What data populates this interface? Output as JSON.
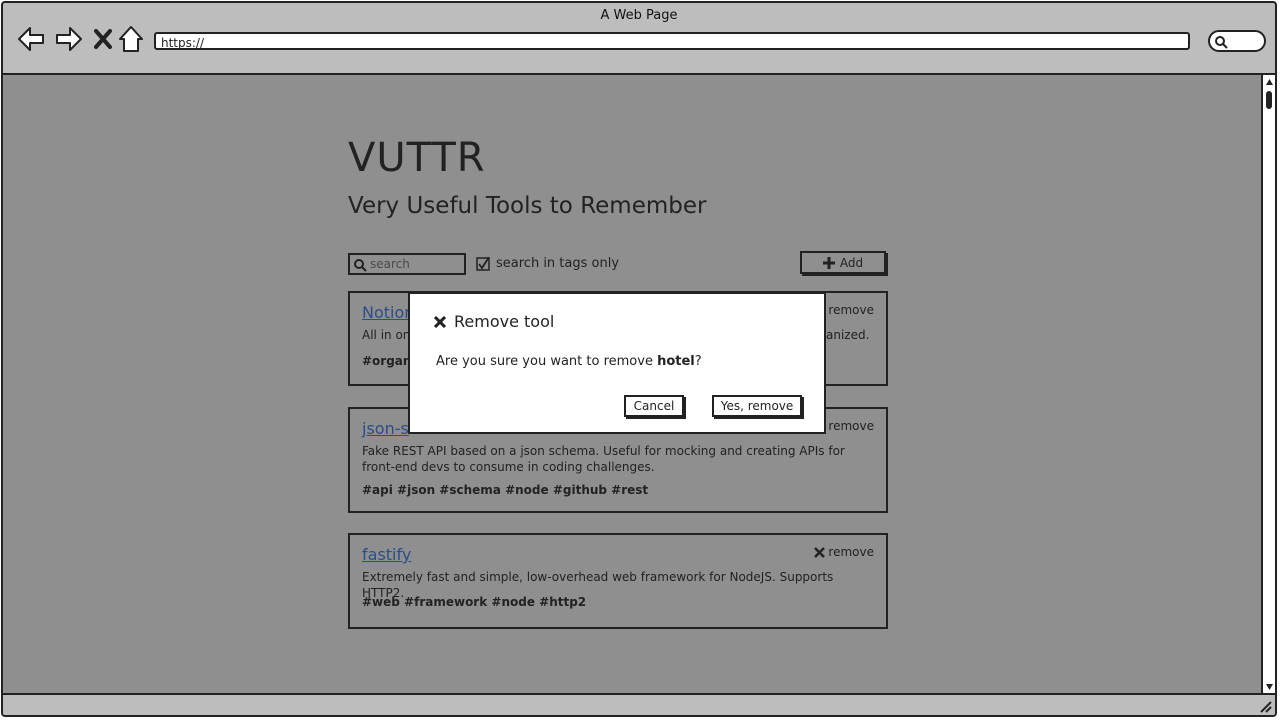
{
  "window": {
    "title": "A Web Page"
  },
  "browser": {
    "url": "https://"
  },
  "page": {
    "heading": "VUTTR",
    "subheading": "Very Useful Tools to Remember",
    "search_placeholder": "search",
    "search_tags_only_label": "search in tags only",
    "add_label": "Add"
  },
  "tools": [
    {
      "name": "Notion",
      "remove_label": "remove",
      "description_left": "All in one",
      "description_right": "anized.",
      "tags": "#organiz"
    },
    {
      "name": "json-s",
      "remove_label": "remove",
      "description": "Fake REST API based on a json schema. Useful for mocking and creating APIs for front-end devs to consume in coding challenges.",
      "tags": "#api #json #schema #node #github #rest"
    },
    {
      "name": "fastify",
      "remove_label": "remove",
      "description": "Extremely fast and simple, low-overhead web framework for NodeJS. Supports HTTP2.",
      "tags": "#web #framework #node #http2"
    }
  ],
  "modal": {
    "title": "Remove tool",
    "message_prefix": "Are you sure you want to remove ",
    "tool_name": "hotel",
    "message_suffix": "?",
    "cancel_label": "Cancel",
    "confirm_label": "Yes, remove"
  },
  "colors": {
    "overlay": "#8f8f8f",
    "link": "#2a4d8a",
    "chrome": "#bdbdbd"
  }
}
